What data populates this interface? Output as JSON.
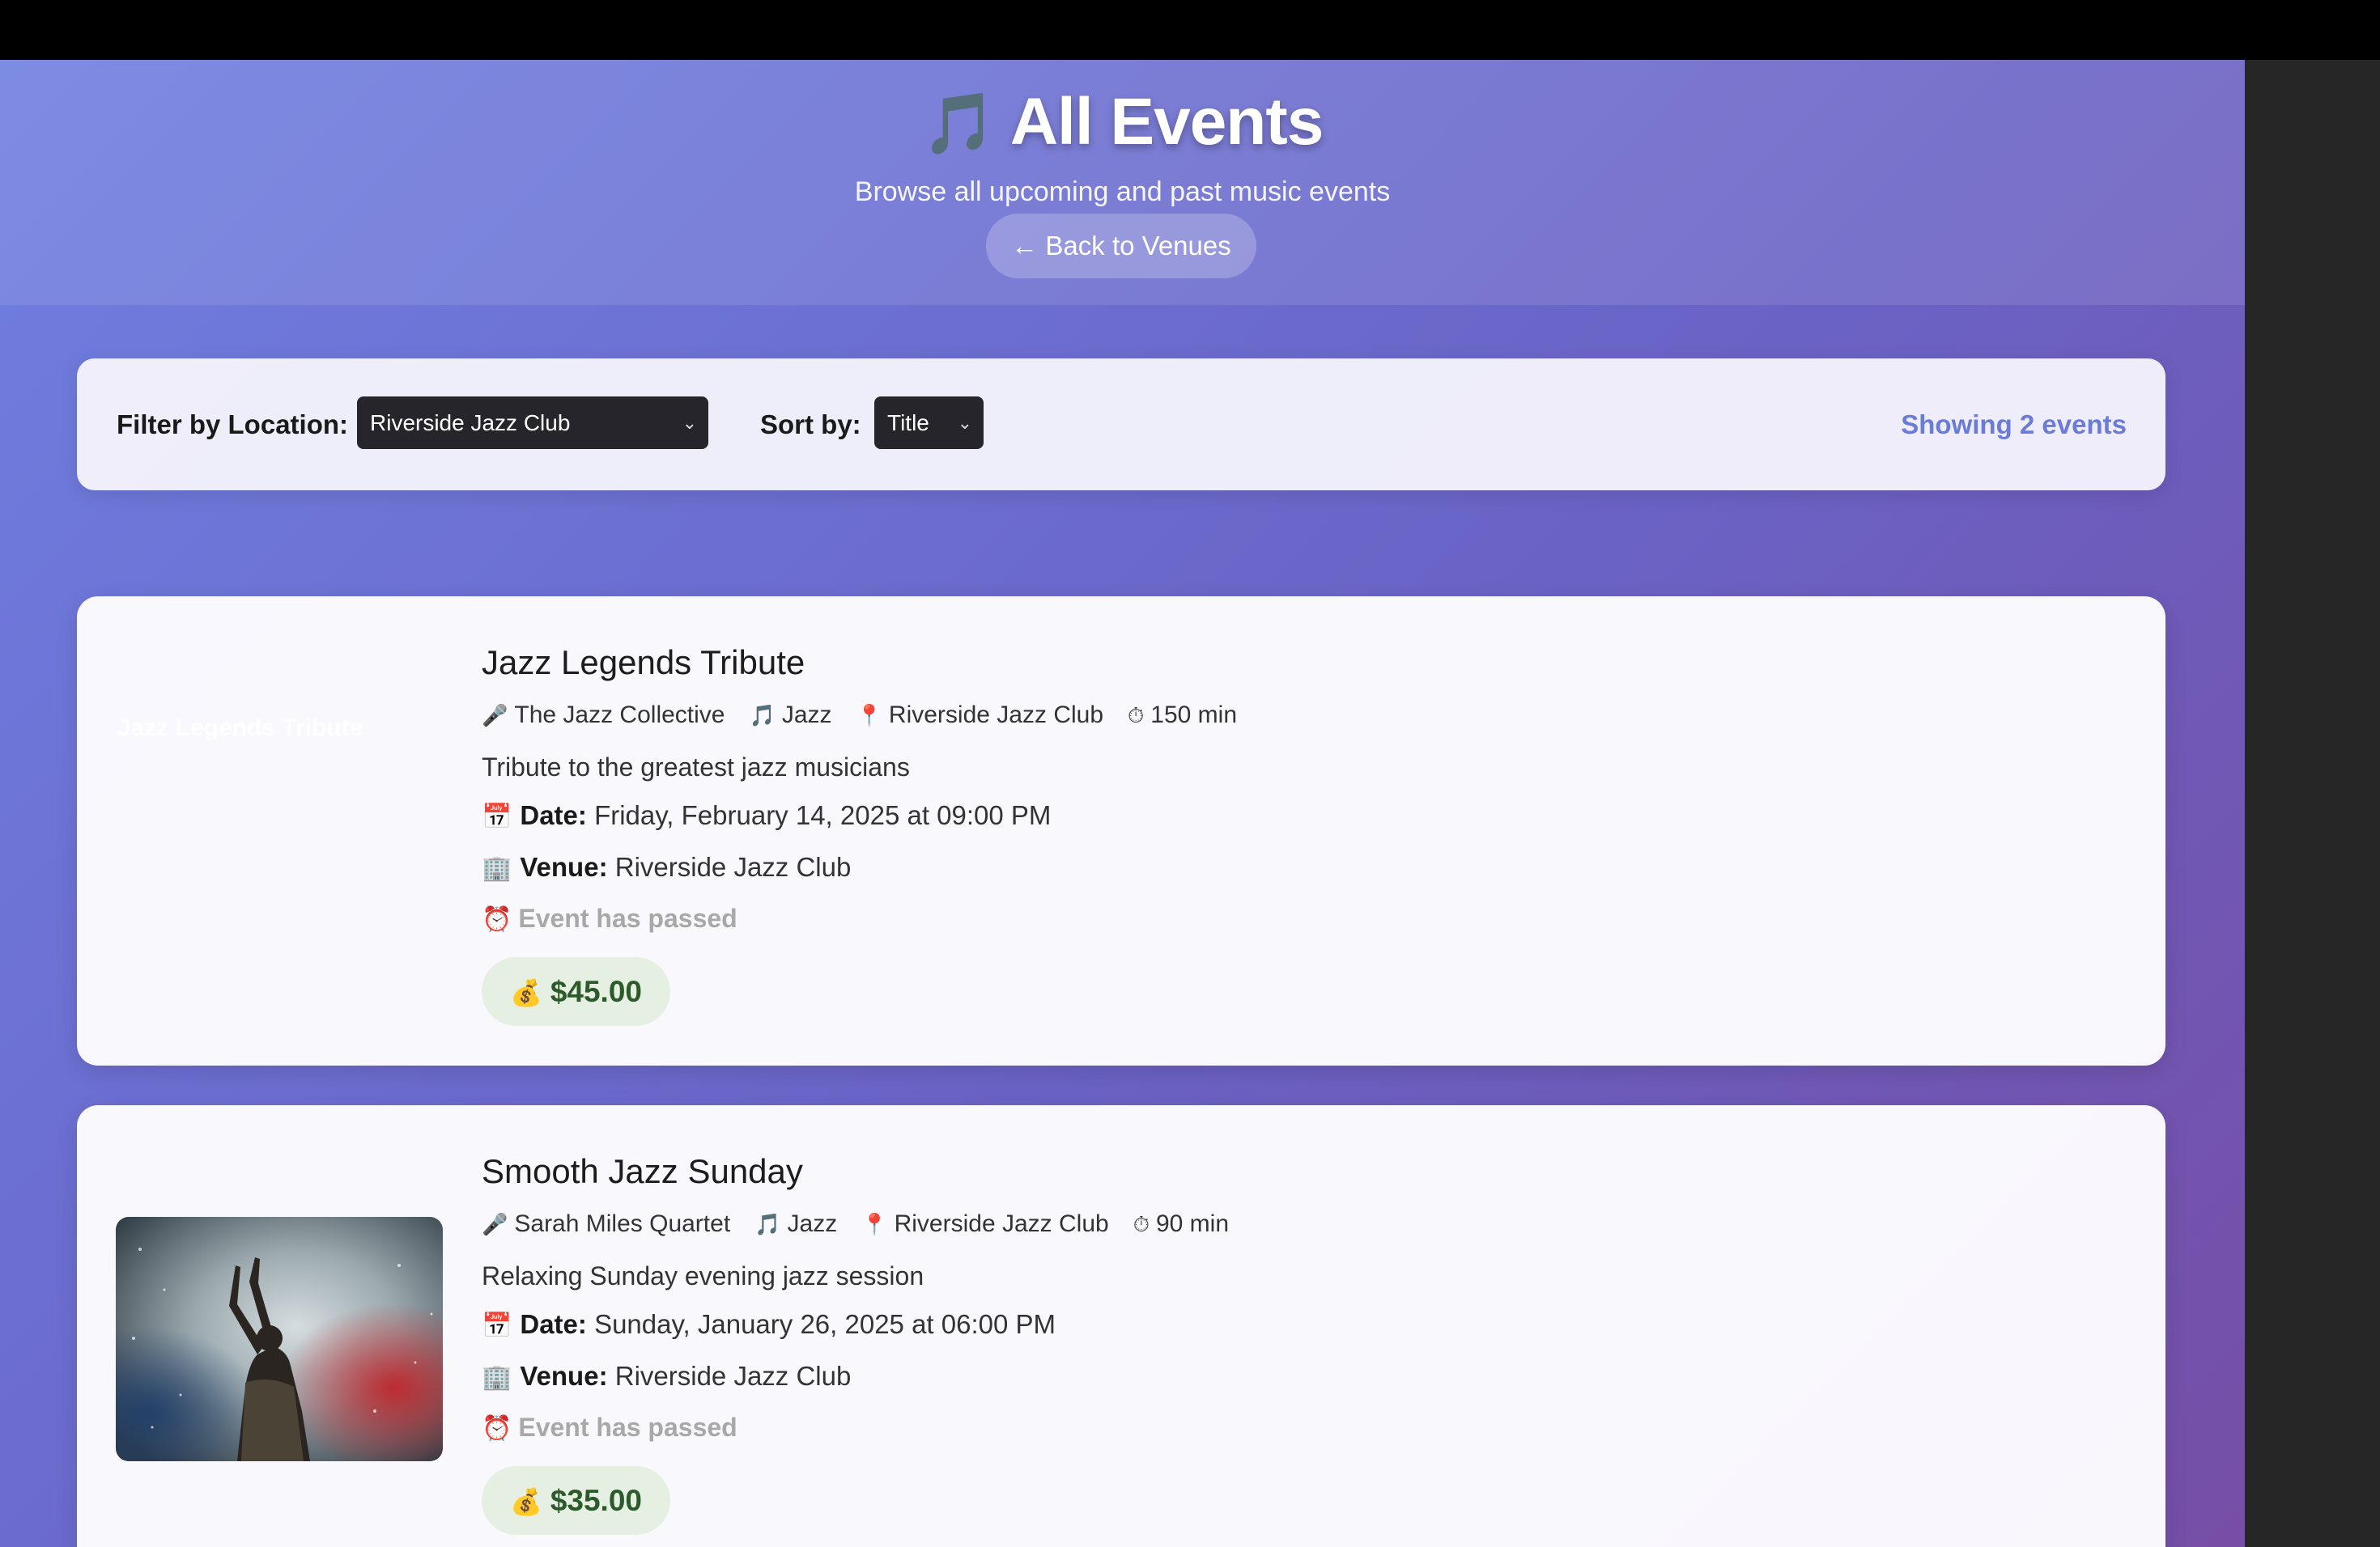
{
  "header": {
    "title_icon": "🎵",
    "title": "All Events",
    "subtitle": "Browse all upcoming and past music events",
    "back_button": "← Back to Venues"
  },
  "filters": {
    "location_label": "Filter by Location:",
    "location_value": "Riverside Jazz Club",
    "sort_label": "Sort by:",
    "sort_value": "Title",
    "count_text": "Showing 2 events"
  },
  "events": [
    {
      "image_alt": "Jazz Legends Tribute",
      "title": "Jazz Legends Tribute",
      "performer": "The Jazz Collective",
      "genre": "Jazz",
      "location": "Riverside Jazz Club",
      "duration": "150 min",
      "description": "Tribute to the greatest jazz musicians",
      "date_label": "Date:",
      "date": "Friday, February 14, 2025 at 09:00 PM",
      "venue_label": "Venue:",
      "venue": "Riverside Jazz Club",
      "status": "Event has passed",
      "price": "$45.00"
    },
    {
      "image_alt": "Smooth Jazz Sunday",
      "title": "Smooth Jazz Sunday",
      "performer": "Sarah Miles Quartet",
      "genre": "Jazz",
      "location": "Riverside Jazz Club",
      "duration": "90 min",
      "description": "Relaxing Sunday evening jazz session",
      "date_label": "Date:",
      "date": "Sunday, January 26, 2025 at 06:00 PM",
      "venue_label": "Venue:",
      "venue": "Riverside Jazz Club",
      "status": "Event has passed",
      "price": "$35.00"
    }
  ],
  "icons": {
    "performer": "🎤",
    "genre": "🎵",
    "location": "📍",
    "duration": "⏱",
    "date": "📅",
    "venue": "🏢",
    "status": "⏰",
    "price": "💰"
  }
}
